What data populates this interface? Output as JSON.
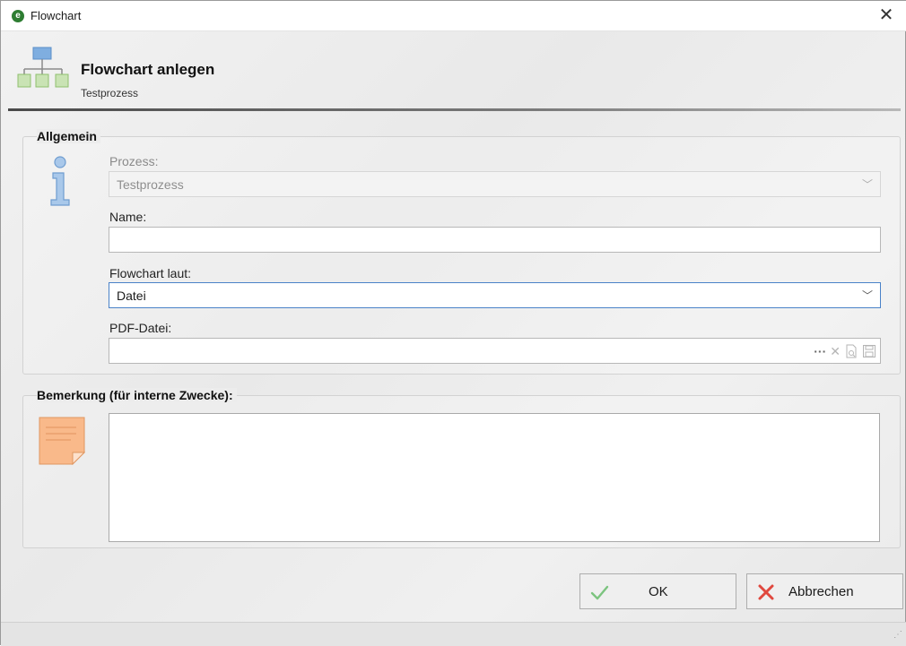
{
  "window": {
    "title": "Flowchart",
    "app_icon_letter": "e"
  },
  "header": {
    "title": "Flowchart anlegen",
    "subtitle": "Testprozess"
  },
  "general": {
    "group_title": "Allgemein",
    "process_label": "Prozess:",
    "process_value": "Testprozess",
    "name_label": "Name:",
    "name_value": "",
    "flowchart_by_label": "Flowchart laut:",
    "flowchart_by_value": "Datei",
    "pdf_label": "PDF-Datei:",
    "pdf_value": "",
    "pdf_tools": {
      "browse": "···",
      "clear": "✕"
    }
  },
  "remark": {
    "group_title": "Bemerkung (für interne Zwecke):",
    "value": ""
  },
  "buttons": {
    "ok": "OK",
    "cancel": "Abbrechen"
  },
  "colors": {
    "accent_blue": "#5b9bd5",
    "icon_green": "#a9d18e",
    "note_orange": "#f8b37a",
    "ok_check": "#6fbf73",
    "cancel_x": "#e0483e"
  }
}
